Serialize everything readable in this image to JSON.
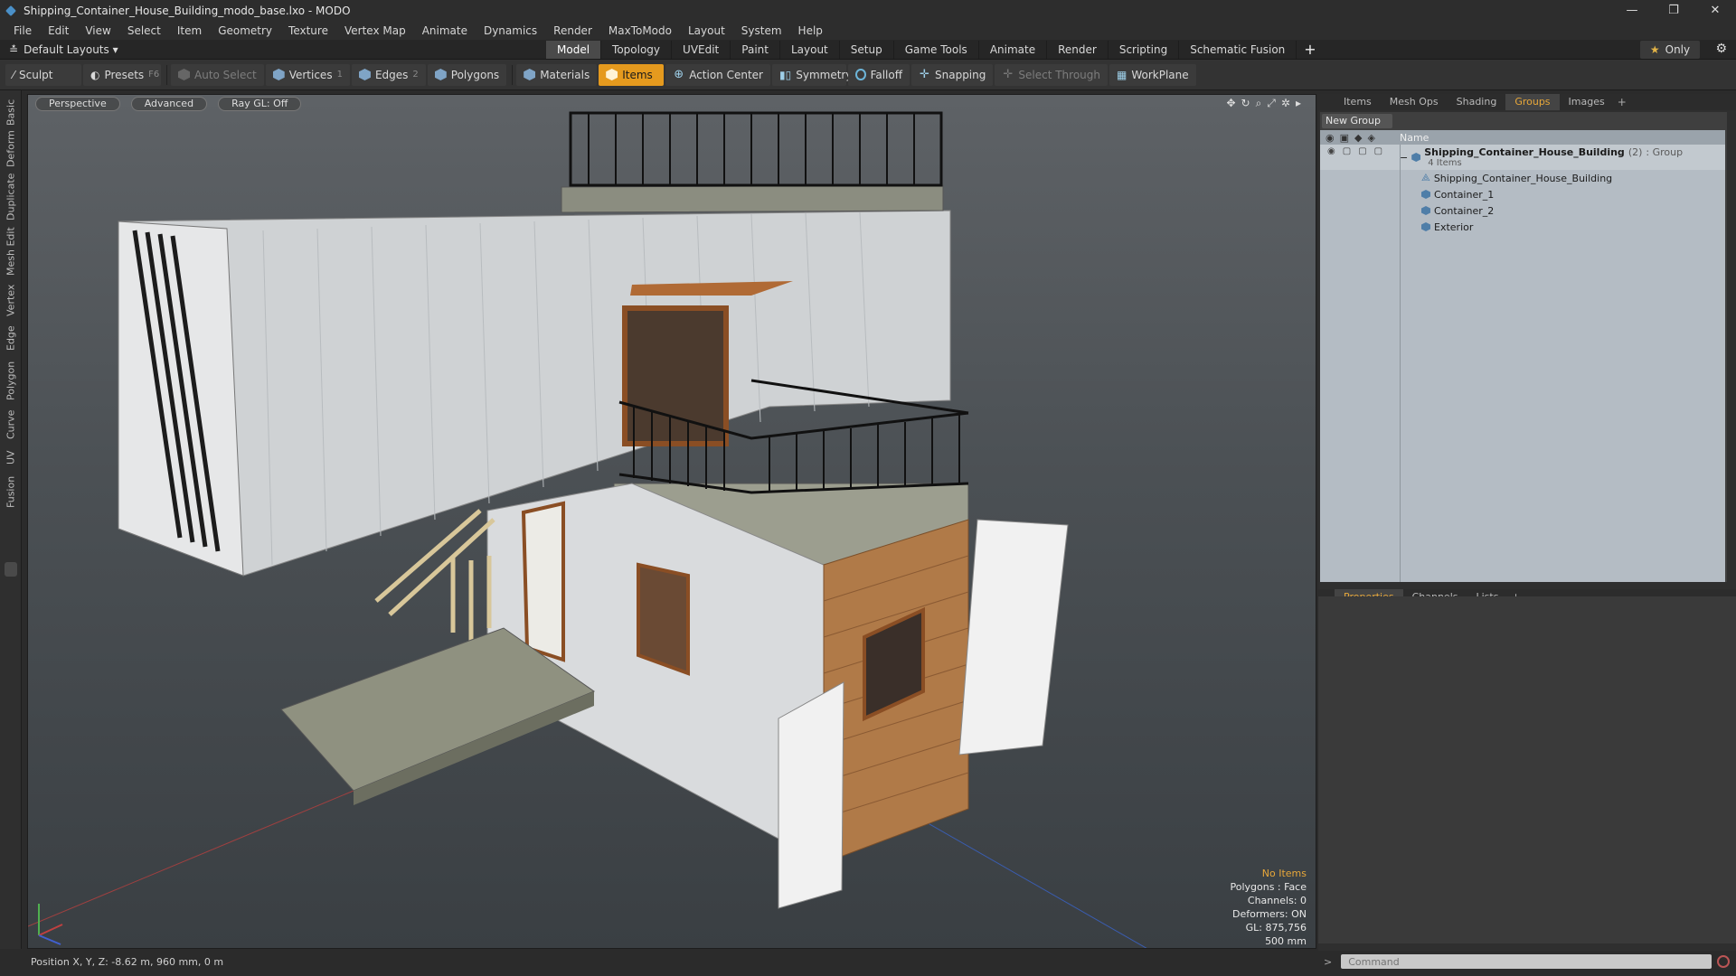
{
  "window": {
    "title": "Shipping_Container_House_Building_modo_base.lxo - MODO",
    "minimize": "—",
    "maximize": "❐",
    "close": "✕"
  },
  "menu": [
    "File",
    "Edit",
    "View",
    "Select",
    "Item",
    "Geometry",
    "Texture",
    "Vertex Map",
    "Animate",
    "Dynamics",
    "Render",
    "MaxToModo",
    "Layout",
    "System",
    "Help"
  ],
  "layoutbar": {
    "layout_label": "Default Layouts ▾",
    "tabs": [
      "Model",
      "Topology",
      "UVEdit",
      "Paint",
      "Layout",
      "Setup",
      "Game Tools",
      "Animate",
      "Render",
      "Scripting",
      "Schematic Fusion"
    ],
    "active_tab": "Model",
    "plus": "+",
    "only_label": "Only"
  },
  "toolbar": {
    "sculpt": "Sculpt",
    "presets": "Presets",
    "presets_key": "F6",
    "auto_select": "Auto Select",
    "vertices": "Vertices",
    "vertices_key": "1",
    "edges": "Edges",
    "edges_key": "2",
    "polygons": "Polygons",
    "materials": "Materials",
    "items": "Items",
    "action_center": "Action Center",
    "symmetry": "Symmetry",
    "falloff": "Falloff",
    "snapping": "Snapping",
    "select_through": "Select Through",
    "workplane": "WorkPlane"
  },
  "left_tabs": [
    "Basic",
    "Deform",
    "Duplicate",
    "Mesh Edit",
    "Vertex",
    "Edge",
    "Polygon",
    "Curve",
    "UV",
    "Fusion"
  ],
  "viewport": {
    "perspective": "Perspective",
    "advanced": "Advanced",
    "raygl": "Ray GL: Off",
    "stats": {
      "no_items": "No Items",
      "polygons": "Polygons : Face",
      "channels": "Channels: 0",
      "deformers": "Deformers: ON",
      "gl": "GL: 875,756",
      "scale": "500 mm"
    }
  },
  "statusbar": {
    "position": "Position X, Y, Z:  -8.62 m, 960 mm, 0 m"
  },
  "groups_panel": {
    "tabs": [
      "Items",
      "Mesh Ops",
      "Shading",
      "Groups",
      "Images"
    ],
    "active_tab": "Groups",
    "new_group": "New Group",
    "col_name": "Name",
    "root": {
      "name": "Shipping_Container_House_Building",
      "count": "(2)",
      "kind": ": Group",
      "items_label": "4 Items"
    },
    "children": [
      "Shipping_Container_House_Building",
      "Container_1",
      "Container_2",
      "Exterior"
    ]
  },
  "properties_panel": {
    "tabs": [
      "Properties",
      "Channels",
      "Lists"
    ],
    "active_tab": "Properties"
  },
  "command": {
    "placeholder": "Command"
  },
  "colors": {
    "accent": "#e59a1e",
    "viewport_bg": "#4b5054"
  }
}
